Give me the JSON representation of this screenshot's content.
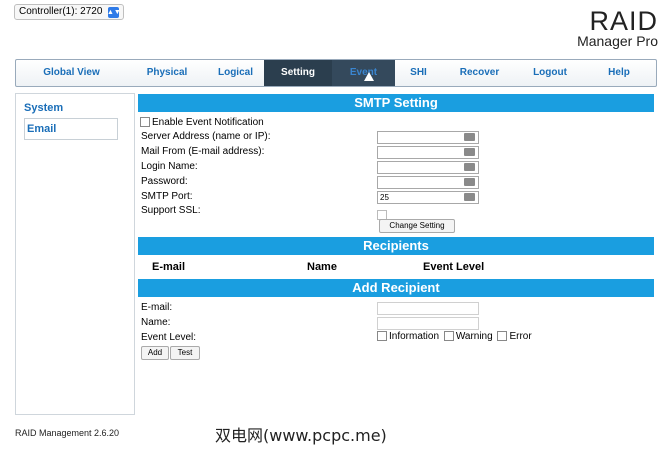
{
  "controller": {
    "label": "Controller(1): 2720"
  },
  "brand": {
    "line1": "RAID",
    "line2": "Manager Pro"
  },
  "nav": {
    "tabs": [
      {
        "label": "Global View"
      },
      {
        "label": "Physical"
      },
      {
        "label": "Logical"
      },
      {
        "label": "Setting"
      },
      {
        "label": "Event"
      },
      {
        "label": "SHI"
      },
      {
        "label": "Recover"
      },
      {
        "label": "Logout"
      },
      {
        "label": "Help"
      }
    ]
  },
  "sidebar": {
    "items": [
      {
        "label": "System"
      },
      {
        "label": "Email"
      }
    ]
  },
  "smtp": {
    "title": "SMTP Setting",
    "enable_label": "Enable Event Notification",
    "fields": [
      {
        "label": "Server Address (name or IP):",
        "value": ""
      },
      {
        "label": "Mail From (E-mail address):",
        "value": ""
      },
      {
        "label": "Login Name:",
        "value": ""
      },
      {
        "label": "Password:",
        "value": ""
      },
      {
        "label": "SMTP Port:",
        "value": "25"
      }
    ],
    "ssl_label": "Support SSL:",
    "change_button": "Change Setting"
  },
  "recipients": {
    "title": "Recipients",
    "columns": [
      "E-mail",
      "Name",
      "Event Level"
    ]
  },
  "add_recipient": {
    "title": "Add Recipient",
    "email_label": "E-mail:",
    "name_label": "Name:",
    "level_label": "Event Level:",
    "levels": [
      "Information",
      "Warning",
      "Error"
    ],
    "add_button": "Add",
    "test_button": "Test"
  },
  "footer": {
    "version": "RAID Management 2.6.20"
  },
  "watermark": {
    "text": "双电网(www.pcpc.me)"
  },
  "colors": {
    "accent": "#1a9ee0",
    "nav_active": "#2b3e4e",
    "link": "#1a6eb8"
  }
}
